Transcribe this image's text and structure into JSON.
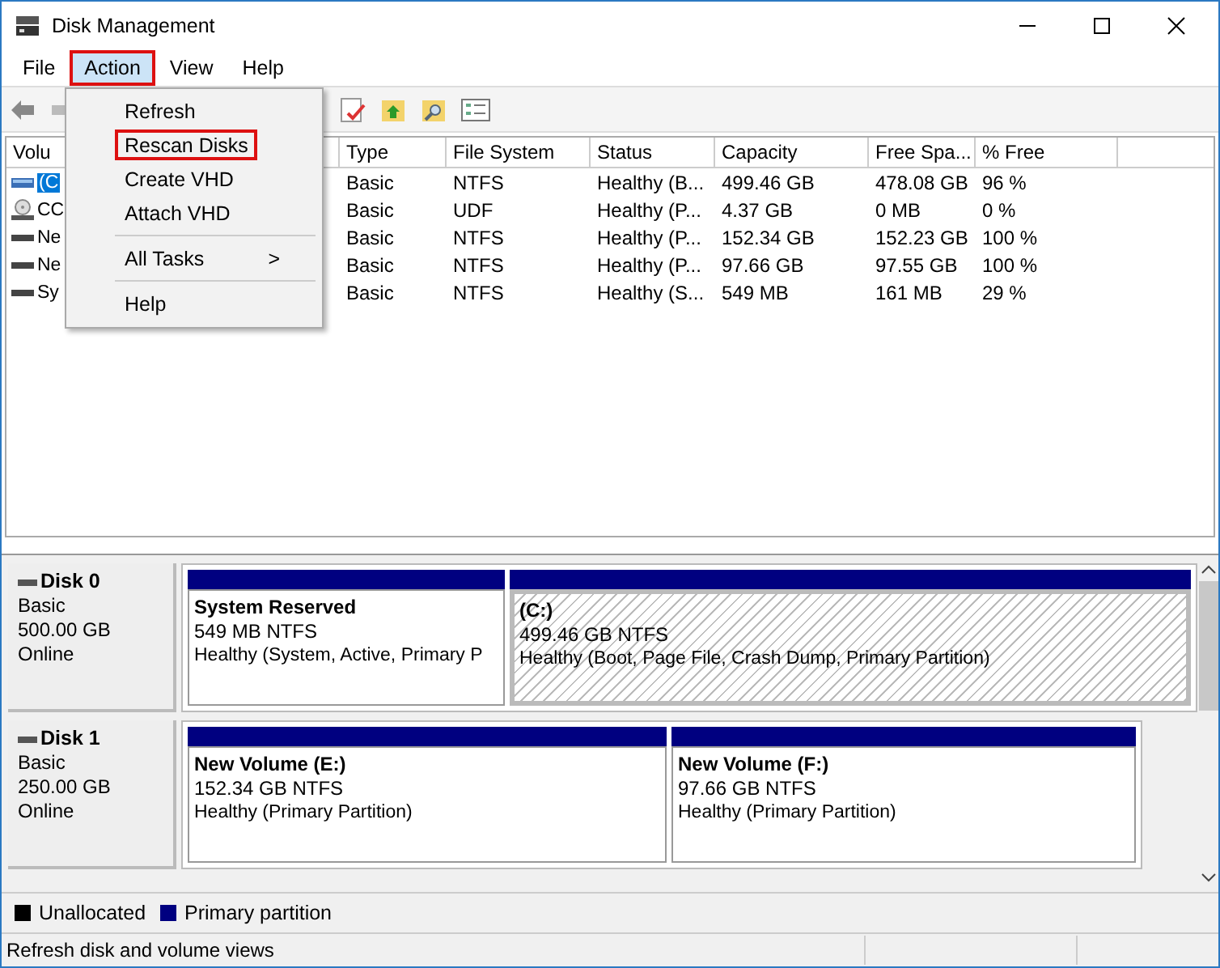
{
  "window": {
    "title": "Disk Management"
  },
  "menu_bar": [
    {
      "label": "File",
      "selected": false
    },
    {
      "label": "Action",
      "selected": true
    },
    {
      "label": "View",
      "selected": false
    },
    {
      "label": "Help",
      "selected": false
    }
  ],
  "action_menu": [
    {
      "kind": "item",
      "label": "Refresh",
      "highlighted": false
    },
    {
      "kind": "item",
      "label": "Rescan Disks",
      "highlighted": true
    },
    {
      "kind": "item",
      "label": "Create VHD",
      "highlighted": false
    },
    {
      "kind": "item",
      "label": "Attach VHD",
      "highlighted": false
    },
    {
      "kind": "separator"
    },
    {
      "kind": "submenu",
      "label": "All Tasks",
      "arrow": ">",
      "highlighted": false
    },
    {
      "kind": "separator"
    },
    {
      "kind": "item",
      "label": "Help",
      "highlighted": false
    }
  ],
  "volume_table": {
    "columns": [
      "Volu",
      "Type",
      "File System",
      "Status",
      "Capacity",
      "Free Spa...",
      "% Free"
    ],
    "rows": [
      {
        "cells": [
          "(C",
          "Basic",
          "NTFS",
          "Healthy (B...",
          "499.46 GB",
          "478.08 GB",
          "96 %"
        ],
        "selected": true
      },
      {
        "cells": [
          "CC",
          "Basic",
          "UDF",
          "Healthy (P...",
          "4.37 GB",
          "0 MB",
          "0 %"
        ],
        "selected": false
      },
      {
        "cells": [
          "Ne",
          "Basic",
          "NTFS",
          "Healthy (P...",
          "152.34 GB",
          "152.23 GB",
          "100 %"
        ],
        "selected": false
      },
      {
        "cells": [
          "Ne",
          "Basic",
          "NTFS",
          "Healthy (P...",
          "97.66 GB",
          "97.55 GB",
          "100 %"
        ],
        "selected": false
      },
      {
        "cells": [
          "Sy",
          "Basic",
          "NTFS",
          "Healthy (S...",
          "549 MB",
          "161 MB",
          "29 %"
        ],
        "selected": false
      }
    ]
  },
  "disks": [
    {
      "name": "Disk 0",
      "type": "Basic",
      "size": "500.00 GB",
      "state": "Online",
      "partitions": [
        {
          "name": "System Reserved",
          "detail": "549 MB NTFS",
          "status": "Healthy (System, Active, Primary P",
          "selected": false
        },
        {
          "name": " (C:)",
          "detail": "499.46 GB NTFS",
          "status": "Healthy (Boot, Page File, Crash Dump, Primary Partition)",
          "selected": true
        }
      ]
    },
    {
      "name": "Disk 1",
      "type": "Basic",
      "size": "250.00 GB",
      "state": "Online",
      "partitions": [
        {
          "name": "New Volume  (E:)",
          "detail": "152.34 GB NTFS",
          "status": "Healthy (Primary Partition)",
          "selected": false
        },
        {
          "name": "New Volume  (F:)",
          "detail": "97.66 GB NTFS",
          "status": "Healthy (Primary Partition)",
          "selected": false
        }
      ]
    }
  ],
  "legend": [
    {
      "label": "Unallocated",
      "color": "#000000"
    },
    {
      "label": "Primary partition",
      "color": "#000080"
    }
  ],
  "status_bar": "Refresh disk and volume views"
}
